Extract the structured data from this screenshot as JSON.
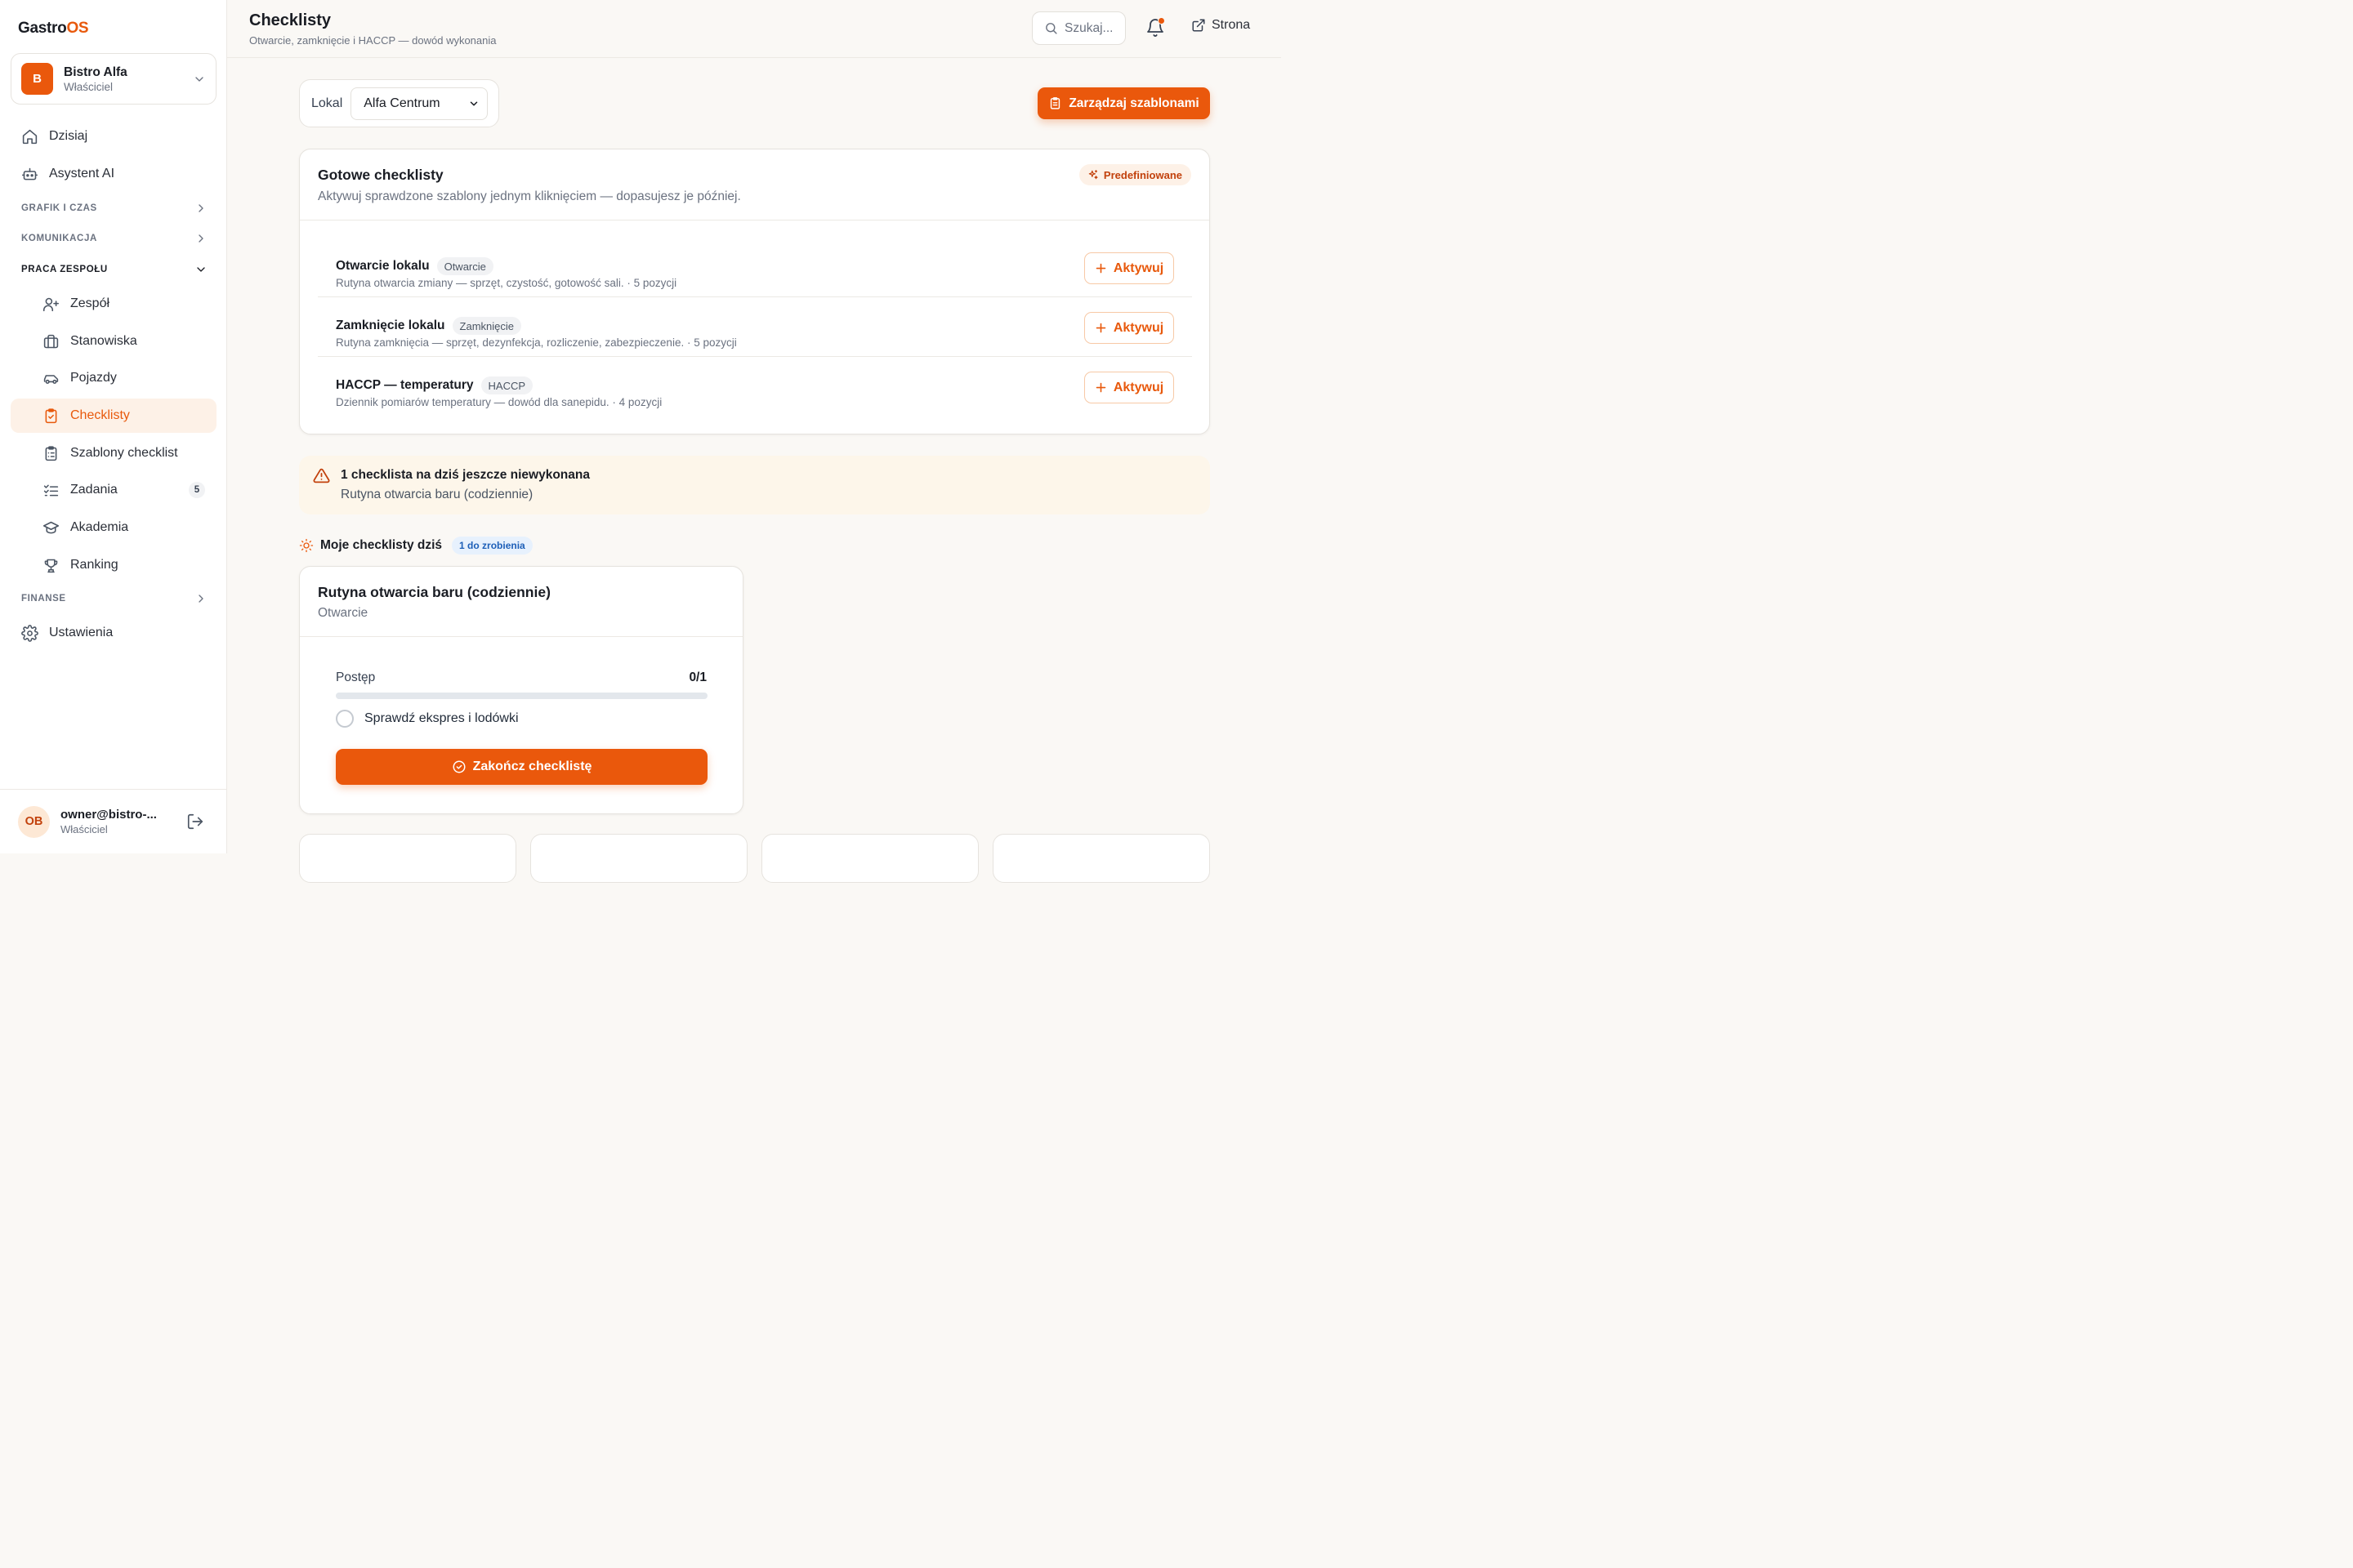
{
  "brand": {
    "name_prefix": "Gastro",
    "name_suffix": "OS",
    "accent": "#ea580c"
  },
  "org": {
    "initial": "B",
    "name": "Bistro Alfa",
    "role": "Właściciel"
  },
  "nav": {
    "today": "Dzisiaj",
    "assistant": "Asystent AI",
    "section_schedule": "GRAFIK I CZAS",
    "section_comms": "KOMUNIKACJA",
    "section_team": "PRACA ZESPOŁU",
    "team": "Zespół",
    "positions": "Stanowiska",
    "vehicles": "Pojazdy",
    "checklists": "Checklisty",
    "templates": "Szablony checklist",
    "tasks": "Zadania",
    "tasks_badge": "5",
    "academy": "Akademia",
    "ranking": "Ranking",
    "section_finance": "FINANSE",
    "settings": "Ustawienia"
  },
  "user": {
    "initials": "OB",
    "email": "owner@bistro-...",
    "role": "Właściciel"
  },
  "header": {
    "title": "Checklisty",
    "subtitle": "Otwarcie, zamknięcie i HACCP — dowód wykonania",
    "search_placeholder": "Szukaj...",
    "site_link": "Strona"
  },
  "location": {
    "label": "Lokal",
    "selected": "Alfa Centrum"
  },
  "manage_button": "Zarządzaj szablonami",
  "presets": {
    "title": "Gotowe checklisty",
    "subtitle": "Aktywuj sprawdzone szablony jednym kliknięciem — dopasujesz je później.",
    "badge": "Predefiniowane",
    "activate_label": "Aktywuj",
    "items": [
      {
        "name": "Otwarcie lokalu",
        "tag": "Otwarcie",
        "desc": "Rutyna otwarcia zmiany — sprzęt, czystość, gotowość sali. · 5 pozycji"
      },
      {
        "name": "Zamknięcie lokalu",
        "tag": "Zamknięcie",
        "desc": "Rutyna zamknięcia — sprzęt, dezynfekcja, rozliczenie, zabezpieczenie. · 5 pozycji"
      },
      {
        "name": "HACCP — temperatury",
        "tag": "HACCP",
        "desc": "Dziennik pomiarów temperatury — dowód dla sanepidu. · 4 pozycji"
      }
    ]
  },
  "alert": {
    "title": "1 checklista na dziś jeszcze niewykonana",
    "detail": "Rutyna otwarcia baru (codziennie)"
  },
  "my_checklists": {
    "title": "Moje checklisty dziś",
    "badge": "1 do zrobienia",
    "card": {
      "title": "Rutyna otwarcia baru (codziennie)",
      "type": "Otwarcie",
      "progress_label": "Postęp",
      "progress_count": "0/1",
      "progress_fraction": 0,
      "items": [
        {
          "label": "Sprawdź ekspres i lodówki",
          "done": false
        }
      ],
      "finish_button": "Zakończ checklistę"
    }
  }
}
